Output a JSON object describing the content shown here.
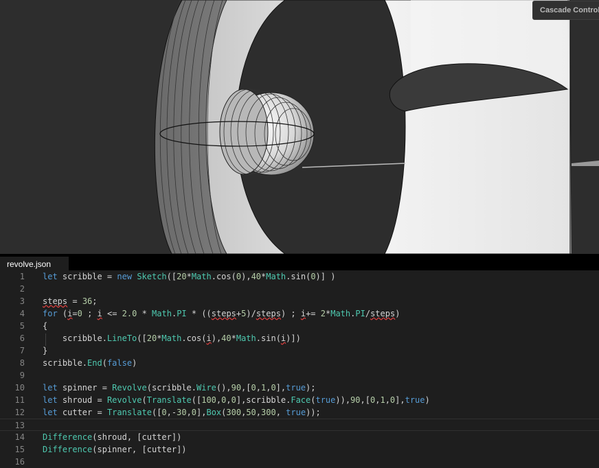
{
  "viewport": {
    "controls_title": "Cascade Control"
  },
  "editor": {
    "tab_label": "revolve.json",
    "lines": [
      {
        "n": "1",
        "tokens": [
          [
            "let",
            "kw"
          ],
          [
            " scribble = ",
            ""
          ],
          [
            "new",
            "kw"
          ],
          [
            " ",
            ""
          ],
          [
            "Sketch",
            "fn"
          ],
          [
            "([",
            ""
          ],
          [
            "20",
            "num"
          ],
          [
            "*",
            ""
          ],
          [
            "Math",
            "fn"
          ],
          [
            ".",
            ""
          ],
          [
            "cos",
            ""
          ],
          [
            "(",
            ""
          ],
          [
            "0",
            "num"
          ],
          [
            "),",
            ""
          ],
          [
            "40",
            "num"
          ],
          [
            "*",
            ""
          ],
          [
            "Math",
            "fn"
          ],
          [
            ".",
            ""
          ],
          [
            "sin",
            ""
          ],
          [
            "(",
            ""
          ],
          [
            "0",
            "num"
          ],
          [
            ")] )",
            ""
          ]
        ]
      },
      {
        "n": "2",
        "tokens": []
      },
      {
        "n": "3",
        "tokens": [
          [
            "steps",
            "sq"
          ],
          [
            " = ",
            ""
          ],
          [
            "36",
            "num"
          ],
          [
            ";",
            ""
          ]
        ]
      },
      {
        "n": "4",
        "tokens": [
          [
            "for",
            "kw"
          ],
          [
            " (",
            ""
          ],
          [
            "i",
            "sq"
          ],
          [
            "=",
            ""
          ],
          [
            "0",
            "num"
          ],
          [
            " ; ",
            ""
          ],
          [
            "i",
            "sq"
          ],
          [
            " <= ",
            ""
          ],
          [
            "2.0",
            "num"
          ],
          [
            " * ",
            ""
          ],
          [
            "Math",
            "fn"
          ],
          [
            ".",
            ""
          ],
          [
            "PI",
            "fn"
          ],
          [
            " * ((",
            ""
          ],
          [
            "steps",
            "sq"
          ],
          [
            "+",
            ""
          ],
          [
            "5",
            "num"
          ],
          [
            ")/",
            ""
          ],
          [
            "steps",
            "sq"
          ],
          [
            ") ; ",
            ""
          ],
          [
            "i",
            "sq"
          ],
          [
            "+= ",
            ""
          ],
          [
            "2",
            "num"
          ],
          [
            "*",
            ""
          ],
          [
            "Math",
            "fn"
          ],
          [
            ".",
            ""
          ],
          [
            "PI",
            "fn"
          ],
          [
            "/",
            ""
          ],
          [
            "steps",
            "sq"
          ],
          [
            ")",
            ""
          ]
        ]
      },
      {
        "n": "5",
        "tokens": [
          [
            "{",
            ""
          ]
        ]
      },
      {
        "n": "6",
        "tokens": [
          [
            "    scribble.",
            ""
          ],
          [
            "LineTo",
            "fn"
          ],
          [
            "([",
            ""
          ],
          [
            "20",
            "num"
          ],
          [
            "*",
            ""
          ],
          [
            "Math",
            "fn"
          ],
          [
            ".",
            ""
          ],
          [
            "cos",
            ""
          ],
          [
            "(",
            ""
          ],
          [
            "i",
            "sq"
          ],
          [
            "),",
            ""
          ],
          [
            "40",
            "num"
          ],
          [
            "*",
            ""
          ],
          [
            "Math",
            "fn"
          ],
          [
            ".",
            ""
          ],
          [
            "sin",
            ""
          ],
          [
            "(",
            ""
          ],
          [
            "i",
            "sq"
          ],
          [
            ")])",
            ""
          ]
        ]
      },
      {
        "n": "7",
        "tokens": [
          [
            "}",
            ""
          ]
        ]
      },
      {
        "n": "8",
        "tokens": [
          [
            "scribble.",
            ""
          ],
          [
            "End",
            "fn"
          ],
          [
            "(",
            ""
          ],
          [
            "false",
            "kw"
          ],
          [
            ")",
            ""
          ]
        ]
      },
      {
        "n": "9",
        "tokens": []
      },
      {
        "n": "10",
        "tokens": [
          [
            "let",
            "kw"
          ],
          [
            " spinner = ",
            ""
          ],
          [
            "Revolve",
            "fn"
          ],
          [
            "(scribble.",
            ""
          ],
          [
            "Wire",
            "fn"
          ],
          [
            "(),",
            ""
          ],
          [
            "90",
            "num"
          ],
          [
            ",[",
            ""
          ],
          [
            "0",
            "num"
          ],
          [
            ",",
            ""
          ],
          [
            "1",
            "num"
          ],
          [
            ",",
            ""
          ],
          [
            "0",
            "num"
          ],
          [
            "],",
            ""
          ],
          [
            "true",
            "kw"
          ],
          [
            ");",
            ""
          ]
        ]
      },
      {
        "n": "11",
        "tokens": [
          [
            "let",
            "kw"
          ],
          [
            " shroud = ",
            ""
          ],
          [
            "Revolve",
            "fn"
          ],
          [
            "(",
            ""
          ],
          [
            "Translate",
            "fn"
          ],
          [
            "([",
            ""
          ],
          [
            "100",
            "num"
          ],
          [
            ",",
            ""
          ],
          [
            "0",
            "num"
          ],
          [
            ",",
            ""
          ],
          [
            "0",
            "num"
          ],
          [
            "],scribble.",
            ""
          ],
          [
            "Face",
            "fn"
          ],
          [
            "(",
            ""
          ],
          [
            "true",
            "kw"
          ],
          [
            ")),",
            ""
          ],
          [
            "90",
            "num"
          ],
          [
            ",[",
            ""
          ],
          [
            "0",
            "num"
          ],
          [
            ",",
            ""
          ],
          [
            "1",
            "num"
          ],
          [
            ",",
            ""
          ],
          [
            "0",
            "num"
          ],
          [
            "],",
            ""
          ],
          [
            "true",
            "kw"
          ],
          [
            ")",
            ""
          ]
        ]
      },
      {
        "n": "12",
        "tokens": [
          [
            "let",
            "kw"
          ],
          [
            " cutter = ",
            ""
          ],
          [
            "Translate",
            "fn"
          ],
          [
            "([",
            ""
          ],
          [
            "0",
            "num"
          ],
          [
            ",-",
            ""
          ],
          [
            "30",
            "num"
          ],
          [
            ",",
            ""
          ],
          [
            "0",
            "num"
          ],
          [
            "],",
            ""
          ],
          [
            "Box",
            "fn"
          ],
          [
            "(",
            ""
          ],
          [
            "300",
            "num"
          ],
          [
            ",",
            ""
          ],
          [
            "50",
            "num"
          ],
          [
            ",",
            ""
          ],
          [
            "300",
            "num"
          ],
          [
            ", ",
            ""
          ],
          [
            "true",
            "kw"
          ],
          [
            "));",
            ""
          ]
        ]
      },
      {
        "n": "13",
        "tokens": [],
        "current": true
      },
      {
        "n": "14",
        "tokens": [
          [
            "Difference",
            "fn"
          ],
          [
            "(shroud, [cutter])",
            ""
          ]
        ]
      },
      {
        "n": "15",
        "tokens": [
          [
            "Difference",
            "fn"
          ],
          [
            "(spinner, [cutter])",
            ""
          ]
        ]
      },
      {
        "n": "16",
        "tokens": []
      }
    ]
  }
}
